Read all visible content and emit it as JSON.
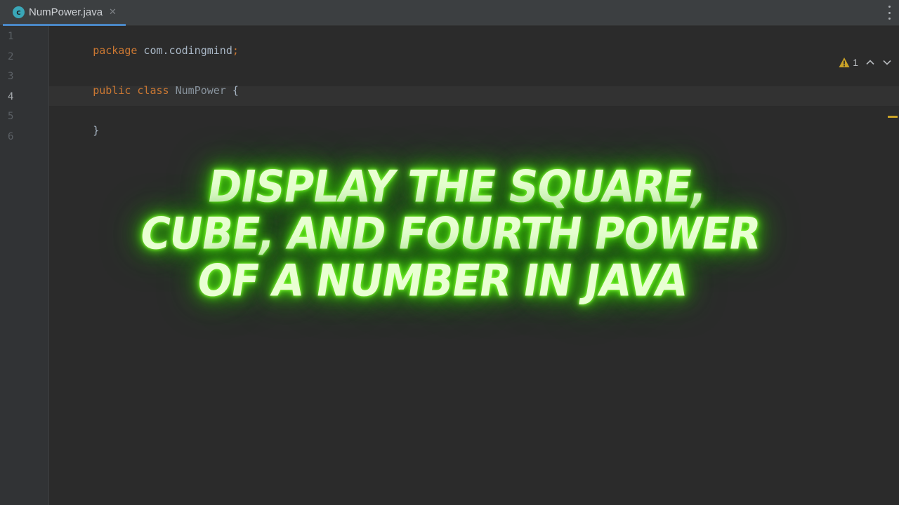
{
  "tabs": [
    {
      "label": "NumPower.java",
      "icon": "java-class-icon",
      "icon_glyph": "c",
      "close_glyph": "✕"
    }
  ],
  "gutter": {
    "line_numbers": [
      "1",
      "2",
      "3",
      "4",
      "5",
      "6"
    ],
    "active_line": "4"
  },
  "code": {
    "line1": {
      "keyword": "package",
      "name": " com.codingmind",
      "semi": ";"
    },
    "line3": {
      "kw1": "public",
      "kw2": "class",
      "classname": "NumPower",
      "brace": " {"
    },
    "line5": {
      "brace": "}"
    }
  },
  "inspections": {
    "warning_count": "1"
  },
  "overlay": {
    "lines": [
      "Display the square,",
      "cube, and fourth power",
      "of a number in Java"
    ]
  },
  "colors": {
    "keyword": "#cc7832",
    "text": "#a9b7c6",
    "glow": "#5fe81c",
    "warning": "#c9a227",
    "tab_underline": "#4a88c7"
  }
}
